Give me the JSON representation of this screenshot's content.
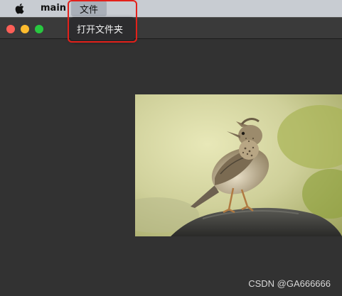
{
  "menubar": {
    "apple_icon": "apple-icon",
    "app_name": "main",
    "file_menu": "文件"
  },
  "file_dropdown": {
    "items": [
      {
        "label": "打开文件夹"
      }
    ]
  },
  "window": {
    "traffic_lights": {
      "close": "#fe5f57",
      "minimize": "#febc2e",
      "zoom": "#28c840"
    }
  },
  "annotation": {
    "highlight_color": "#e3211b"
  },
  "image": {
    "subject": "bird"
  },
  "watermark": "CSDN @GA666666"
}
